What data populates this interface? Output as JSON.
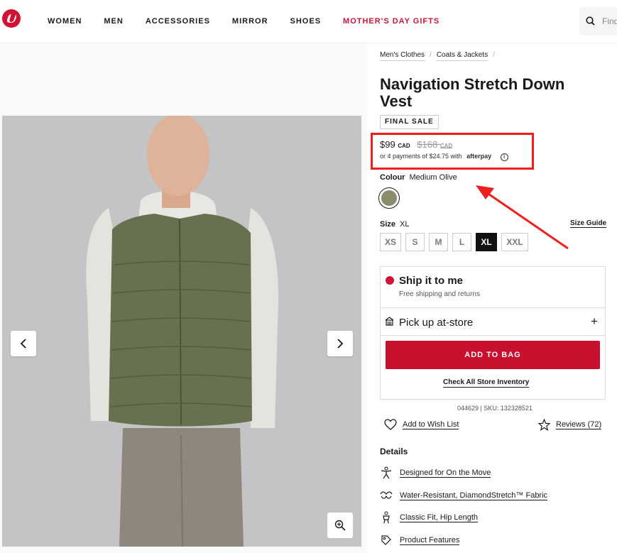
{
  "nav": {
    "items": [
      "WOMEN",
      "MEN",
      "ACCESSORIES",
      "MIRROR",
      "SHOES"
    ],
    "gift": "MOTHER'S DAY GIFTS",
    "search_placeholder": "Find"
  },
  "breadcrumb": [
    "Men's Clothes",
    "Coats & Jackets"
  ],
  "product": {
    "title": "Navigation Stretch Down Vest",
    "badge": "FINAL SALE",
    "price": "$99",
    "price_currency": "CAD",
    "old_price": "$168",
    "old_currency": "CAD",
    "afterpay_text": "or 4 payments of $24.75 with",
    "afterpay_brand": "afterpay",
    "colour_label": "Colour",
    "colour_value": "Medium Olive",
    "swatch_color": "#8c8b6c",
    "size_label": "Size",
    "size_value": "XL",
    "size_guide": "Size Guide",
    "sizes": [
      "XS",
      "S",
      "M",
      "L",
      "XL",
      "XXL"
    ]
  },
  "fulfilment": {
    "ship_title": "Ship it to me",
    "ship_sub": "Free shipping and returns",
    "pickup": "Pick up at-store",
    "add_to_bag": "ADD TO BAG",
    "check_inventory": "Check All Store Inventory"
  },
  "sku": "044629 | SKU: 132328521",
  "wishlist": "Add to Wish List",
  "reviews": "Reviews (72)",
  "details": {
    "heading": "Details",
    "items": [
      {
        "label": "Designed for On the Move",
        "icon": "figure-icon"
      },
      {
        "label": "Water-Resistant, DiamondStretch™ Fabric",
        "icon": "fabric-icon"
      },
      {
        "label": "Classic Fit, Hip Length",
        "icon": "fit-icon"
      },
      {
        "label": "Product Features",
        "icon": "features-icon"
      }
    ]
  },
  "colors": {
    "brand_red": "#d31334",
    "annotation_red": "#f01e1e"
  }
}
